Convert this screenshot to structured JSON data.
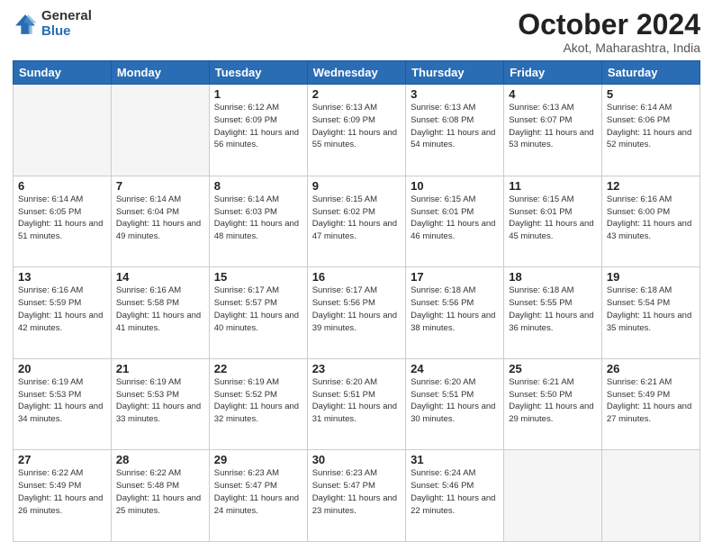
{
  "logo": {
    "general": "General",
    "blue": "Blue"
  },
  "header": {
    "month": "October 2024",
    "location": "Akot, Maharashtra, India"
  },
  "weekdays": [
    "Sunday",
    "Monday",
    "Tuesday",
    "Wednesday",
    "Thursday",
    "Friday",
    "Saturday"
  ],
  "weeks": [
    [
      {
        "day": "",
        "info": ""
      },
      {
        "day": "",
        "info": ""
      },
      {
        "day": "1",
        "info": "Sunrise: 6:12 AM\nSunset: 6:09 PM\nDaylight: 11 hours and 56 minutes."
      },
      {
        "day": "2",
        "info": "Sunrise: 6:13 AM\nSunset: 6:09 PM\nDaylight: 11 hours and 55 minutes."
      },
      {
        "day": "3",
        "info": "Sunrise: 6:13 AM\nSunset: 6:08 PM\nDaylight: 11 hours and 54 minutes."
      },
      {
        "day": "4",
        "info": "Sunrise: 6:13 AM\nSunset: 6:07 PM\nDaylight: 11 hours and 53 minutes."
      },
      {
        "day": "5",
        "info": "Sunrise: 6:14 AM\nSunset: 6:06 PM\nDaylight: 11 hours and 52 minutes."
      }
    ],
    [
      {
        "day": "6",
        "info": "Sunrise: 6:14 AM\nSunset: 6:05 PM\nDaylight: 11 hours and 51 minutes."
      },
      {
        "day": "7",
        "info": "Sunrise: 6:14 AM\nSunset: 6:04 PM\nDaylight: 11 hours and 49 minutes."
      },
      {
        "day": "8",
        "info": "Sunrise: 6:14 AM\nSunset: 6:03 PM\nDaylight: 11 hours and 48 minutes."
      },
      {
        "day": "9",
        "info": "Sunrise: 6:15 AM\nSunset: 6:02 PM\nDaylight: 11 hours and 47 minutes."
      },
      {
        "day": "10",
        "info": "Sunrise: 6:15 AM\nSunset: 6:01 PM\nDaylight: 11 hours and 46 minutes."
      },
      {
        "day": "11",
        "info": "Sunrise: 6:15 AM\nSunset: 6:01 PM\nDaylight: 11 hours and 45 minutes."
      },
      {
        "day": "12",
        "info": "Sunrise: 6:16 AM\nSunset: 6:00 PM\nDaylight: 11 hours and 43 minutes."
      }
    ],
    [
      {
        "day": "13",
        "info": "Sunrise: 6:16 AM\nSunset: 5:59 PM\nDaylight: 11 hours and 42 minutes."
      },
      {
        "day": "14",
        "info": "Sunrise: 6:16 AM\nSunset: 5:58 PM\nDaylight: 11 hours and 41 minutes."
      },
      {
        "day": "15",
        "info": "Sunrise: 6:17 AM\nSunset: 5:57 PM\nDaylight: 11 hours and 40 minutes."
      },
      {
        "day": "16",
        "info": "Sunrise: 6:17 AM\nSunset: 5:56 PM\nDaylight: 11 hours and 39 minutes."
      },
      {
        "day": "17",
        "info": "Sunrise: 6:18 AM\nSunset: 5:56 PM\nDaylight: 11 hours and 38 minutes."
      },
      {
        "day": "18",
        "info": "Sunrise: 6:18 AM\nSunset: 5:55 PM\nDaylight: 11 hours and 36 minutes."
      },
      {
        "day": "19",
        "info": "Sunrise: 6:18 AM\nSunset: 5:54 PM\nDaylight: 11 hours and 35 minutes."
      }
    ],
    [
      {
        "day": "20",
        "info": "Sunrise: 6:19 AM\nSunset: 5:53 PM\nDaylight: 11 hours and 34 minutes."
      },
      {
        "day": "21",
        "info": "Sunrise: 6:19 AM\nSunset: 5:53 PM\nDaylight: 11 hours and 33 minutes."
      },
      {
        "day": "22",
        "info": "Sunrise: 6:19 AM\nSunset: 5:52 PM\nDaylight: 11 hours and 32 minutes."
      },
      {
        "day": "23",
        "info": "Sunrise: 6:20 AM\nSunset: 5:51 PM\nDaylight: 11 hours and 31 minutes."
      },
      {
        "day": "24",
        "info": "Sunrise: 6:20 AM\nSunset: 5:51 PM\nDaylight: 11 hours and 30 minutes."
      },
      {
        "day": "25",
        "info": "Sunrise: 6:21 AM\nSunset: 5:50 PM\nDaylight: 11 hours and 29 minutes."
      },
      {
        "day": "26",
        "info": "Sunrise: 6:21 AM\nSunset: 5:49 PM\nDaylight: 11 hours and 27 minutes."
      }
    ],
    [
      {
        "day": "27",
        "info": "Sunrise: 6:22 AM\nSunset: 5:49 PM\nDaylight: 11 hours and 26 minutes."
      },
      {
        "day": "28",
        "info": "Sunrise: 6:22 AM\nSunset: 5:48 PM\nDaylight: 11 hours and 25 minutes."
      },
      {
        "day": "29",
        "info": "Sunrise: 6:23 AM\nSunset: 5:47 PM\nDaylight: 11 hours and 24 minutes."
      },
      {
        "day": "30",
        "info": "Sunrise: 6:23 AM\nSunset: 5:47 PM\nDaylight: 11 hours and 23 minutes."
      },
      {
        "day": "31",
        "info": "Sunrise: 6:24 AM\nSunset: 5:46 PM\nDaylight: 11 hours and 22 minutes."
      },
      {
        "day": "",
        "info": ""
      },
      {
        "day": "",
        "info": ""
      }
    ]
  ]
}
